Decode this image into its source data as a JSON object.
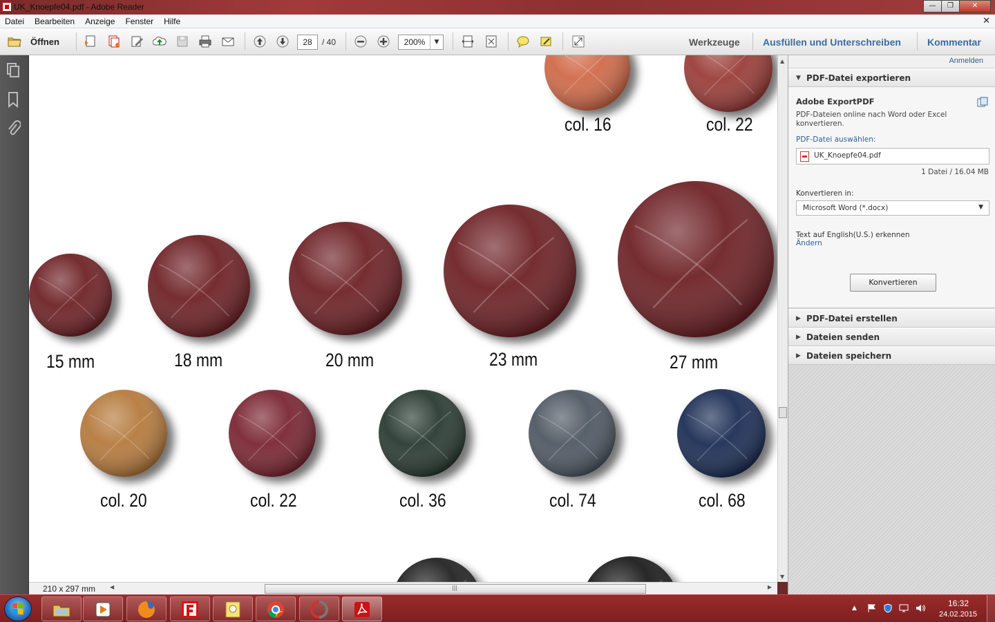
{
  "window": {
    "title": "UK_Knoepfe04.pdf - Adobe Reader"
  },
  "menu": {
    "items": [
      "Datei",
      "Bearbeiten",
      "Anzeige",
      "Fenster",
      "Hilfe"
    ],
    "close_glyph": "✕"
  },
  "toolbar": {
    "open_label": "Öffnen",
    "page_current": "28",
    "page_total": "/ 40",
    "zoom": "200%",
    "tools_label": "Werkzeuge",
    "fill_sign_label": "Ausfüllen und Unterschreiben",
    "comment_label": "Kommentar"
  },
  "document": {
    "top_labels": [
      "col. 16",
      "col. 22"
    ],
    "size_labels": [
      "15 mm",
      "18 mm",
      "20 mm",
      "23 mm",
      "27 mm"
    ],
    "color_labels": [
      "col. 20",
      "col. 22",
      "col. 36",
      "col. 74",
      "col. 68"
    ],
    "button_colors": {
      "col16": "#d06a4a",
      "col22top": "#9a3c38",
      "brown": "#6e2226",
      "col20": "#b57a3c",
      "col22": "#7a2630",
      "col36": "#2a3a32",
      "col74": "#505863",
      "col68": "#1f2f55"
    },
    "page_size": "210 x 297 mm"
  },
  "rightpane": {
    "signin": "Anmelden",
    "export_header": "PDF-Datei exportieren",
    "service_title": "Adobe ExportPDF",
    "service_desc": "PDF-Dateien online nach Word oder Excel konvertieren.",
    "select_label": "PDF-Datei auswählen:",
    "file_name": "UK_Knoepfe04.pdf",
    "file_info": "1 Datei / 16.04 MB",
    "convert_to_label": "Konvertieren in:",
    "format_value": "Microsoft Word (*.docx)",
    "ocr_text": "Text auf English(U.S.) erkennen",
    "change_link": "Ändern",
    "convert_button": "Konvertieren",
    "sections": [
      "PDF-Datei erstellen",
      "Dateien senden",
      "Dateien speichern"
    ]
  },
  "taskbar": {
    "time": "16:32",
    "date": "24.02.2015"
  }
}
